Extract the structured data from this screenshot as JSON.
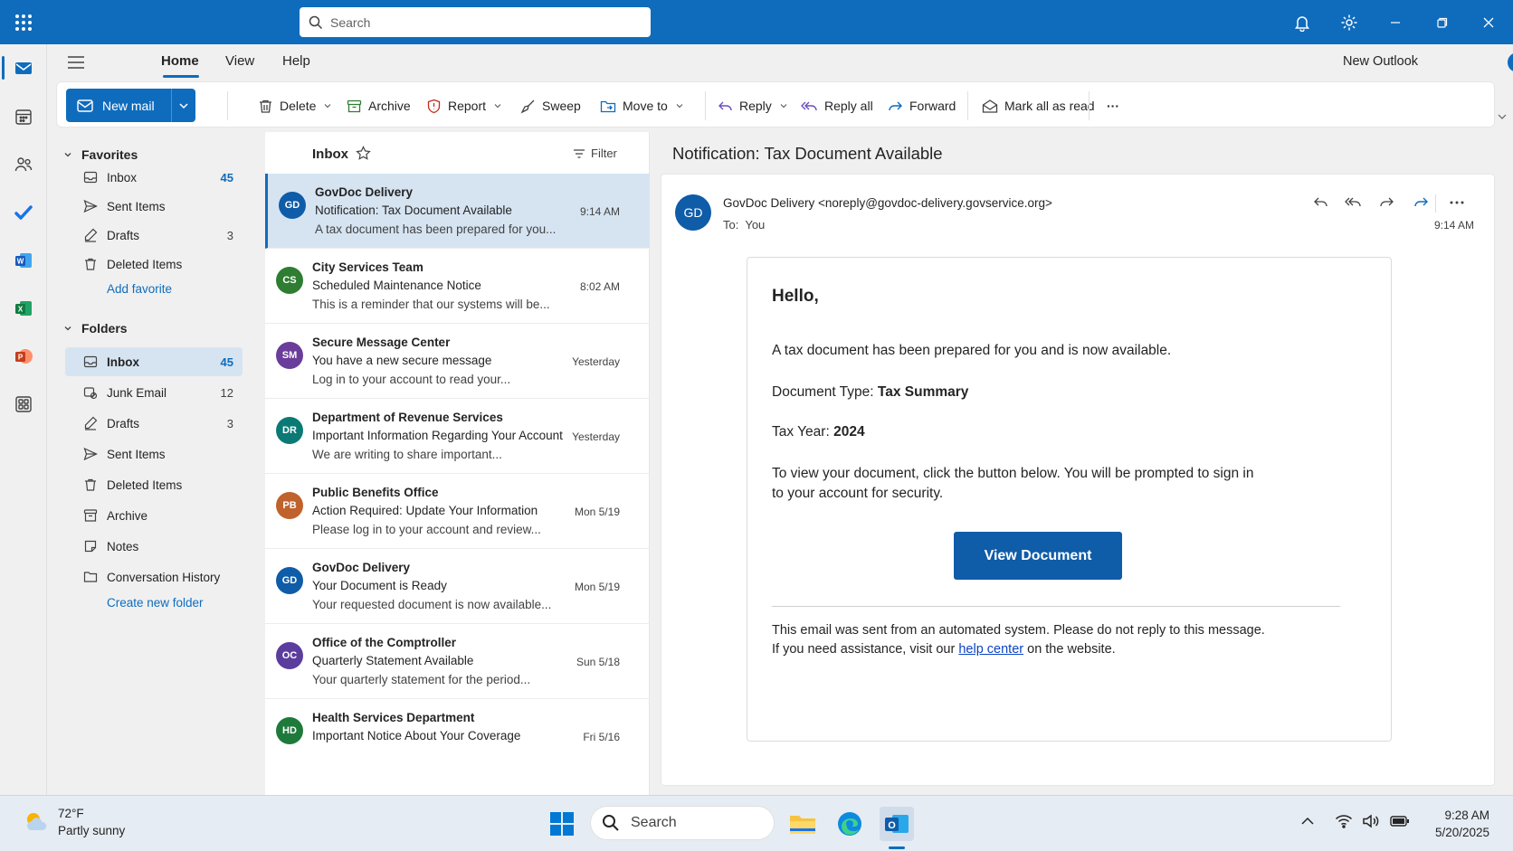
{
  "titlebar": {
    "search_placeholder": "Search"
  },
  "ribbon_tabs": {
    "home": "Home",
    "view": "View",
    "help": "Help",
    "new_outlook_label": "New Outlook",
    "new_outlook_on": true
  },
  "ribbon": {
    "new_mail": "New mail",
    "delete": "Delete",
    "archive": "Archive",
    "report": "Report",
    "sweep": "Sweep",
    "move_to": "Move to",
    "reply": "Reply",
    "reply_all": "Reply all",
    "forward": "Forward",
    "mark_all_read": "Mark all as read",
    "more": "···"
  },
  "nav": {
    "favorites_label": "Favorites",
    "favorites": [
      {
        "label": "Inbox",
        "count": "45",
        "icon": "inbox-icon"
      },
      {
        "label": "Sent Items",
        "count": "",
        "icon": "send-icon"
      },
      {
        "label": "Drafts",
        "count": "3",
        "icon": "drafts-icon"
      },
      {
        "label": "Deleted Items",
        "count": "",
        "icon": "trash-icon"
      }
    ],
    "add_favorite": "Add favorite",
    "folders_label": "Folders",
    "folders": [
      {
        "label": "Inbox",
        "count": "45",
        "icon": "inbox-icon",
        "selected": true
      },
      {
        "label": "Junk Email",
        "count": "12",
        "icon": "junk-icon"
      },
      {
        "label": "Drafts",
        "count": "3",
        "icon": "drafts-icon"
      },
      {
        "label": "Sent Items",
        "count": "",
        "icon": "send-icon"
      },
      {
        "label": "Deleted Items",
        "count": "",
        "icon": "trash-icon"
      },
      {
        "label": "Archive",
        "count": "",
        "icon": "archive-icon"
      },
      {
        "label": "Notes",
        "count": "",
        "icon": "note-icon"
      },
      {
        "label": "Conversation History",
        "count": "",
        "icon": "folder-icon"
      }
    ],
    "create_folder": "Create new folder"
  },
  "message_list": {
    "title": "Inbox",
    "filter": "Filter",
    "messages": [
      {
        "initials": "GD",
        "color": "#0f5ca8",
        "from": "GovDoc Delivery",
        "subject": "Notification: Tax Document Available",
        "preview": "A tax document has been prepared for you...",
        "time": "9:14 AM",
        "selected": true
      },
      {
        "initials": "CS",
        "color": "#2e7d32",
        "from": "City Services Team",
        "subject": "Scheduled Maintenance Notice",
        "preview": "This is a reminder that our systems will be...",
        "time": "8:02 AM"
      },
      {
        "initials": "SM",
        "color": "#6a3d9a",
        "from": "Secure Message Center",
        "subject": "You have a new secure message",
        "preview": "Log in to your account to read your...",
        "time": "Yesterday"
      },
      {
        "initials": "DR",
        "color": "#0b7a75",
        "from": "Department of Revenue Services",
        "subject": "Important Information Regarding Your Account",
        "preview": "We are writing to share important...",
        "time": "Yesterday"
      },
      {
        "initials": "PB",
        "color": "#c0622b",
        "from": "Public Benefits Office",
        "subject": "Action Required: Update Your Information",
        "preview": "Please log in to your account and review...",
        "time": "Mon 5/19"
      },
      {
        "initials": "GD",
        "color": "#0f5ca8",
        "from": "GovDoc Delivery",
        "subject": "Your Document is Ready",
        "preview": "Your requested document is now available...",
        "time": "Mon 5/19"
      },
      {
        "initials": "OC",
        "color": "#5b3d9e",
        "from": "Office of the Comptroller",
        "subject": "Quarterly Statement Available",
        "preview": "Your quarterly statement for the period...",
        "time": "Sun 5/18"
      },
      {
        "initials": "HD",
        "color": "#1e7a3a",
        "from": "Health Services Department",
        "subject": "Important Notice About Your Coverage",
        "preview": "",
        "time": "Fri 5/16"
      }
    ]
  },
  "reading": {
    "subject": "Notification: Tax Document Available",
    "avatar": "GD",
    "from": "GovDoc Delivery <noreply@govdoc-delivery.govservice.org>",
    "to_label": "To:",
    "to": "You",
    "time": "9:14 AM",
    "greeting": "Hello,",
    "line1": "A tax document has been prepared for you and is now available.",
    "doc_type_label": "Document Type:",
    "doc_type": "Tax Summary",
    "tax_year_label": "Tax Year:",
    "tax_year": "2024",
    "instructions_1": "To view your document, click the button below. You will be prompted to sign in",
    "instructions_2": "to your account for security.",
    "button": "View Document",
    "footer_1": "This email was sent from an automated system. Please do not reply to this message.",
    "footer_2a": "If you need assistance, visit our",
    "footer_link": "help center",
    "footer_2b": "on the website."
  },
  "taskbar": {
    "temperature": "72°F",
    "weather": "Partly sunny",
    "search": "Search",
    "time": "9:28 AM",
    "date": "5/20/2025"
  }
}
